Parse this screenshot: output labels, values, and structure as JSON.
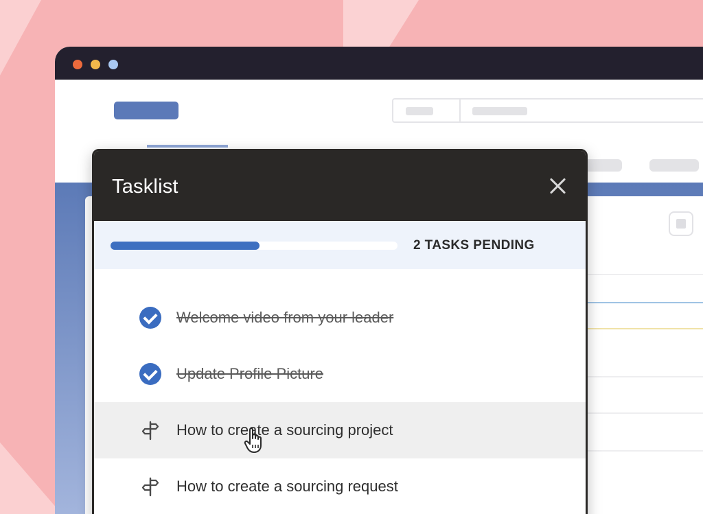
{
  "tasklist": {
    "title": "Tasklist",
    "close_icon": "close-icon",
    "progress": {
      "fraction": 0.52,
      "status_text": "2 TASKS PENDING"
    },
    "tasks": [
      {
        "label": "Welcome video from your leader",
        "completed": true,
        "icon": "check-circle-icon"
      },
      {
        "label": "Update Profile Picture",
        "completed": true,
        "icon": "check-circle-icon"
      },
      {
        "label": "How to create a sourcing project",
        "completed": false,
        "icon": "signpost-icon",
        "hovered": true
      },
      {
        "label": "How to create a sourcing request",
        "completed": false,
        "icon": "signpost-icon"
      }
    ]
  },
  "colors": {
    "background": "#f7b3b5",
    "titlebar": "#23202e",
    "accent": "#3d6fc0",
    "popup_header": "#2a2826"
  },
  "window_controls": [
    "close-dot",
    "minimize-dot",
    "maximize-dot"
  ]
}
